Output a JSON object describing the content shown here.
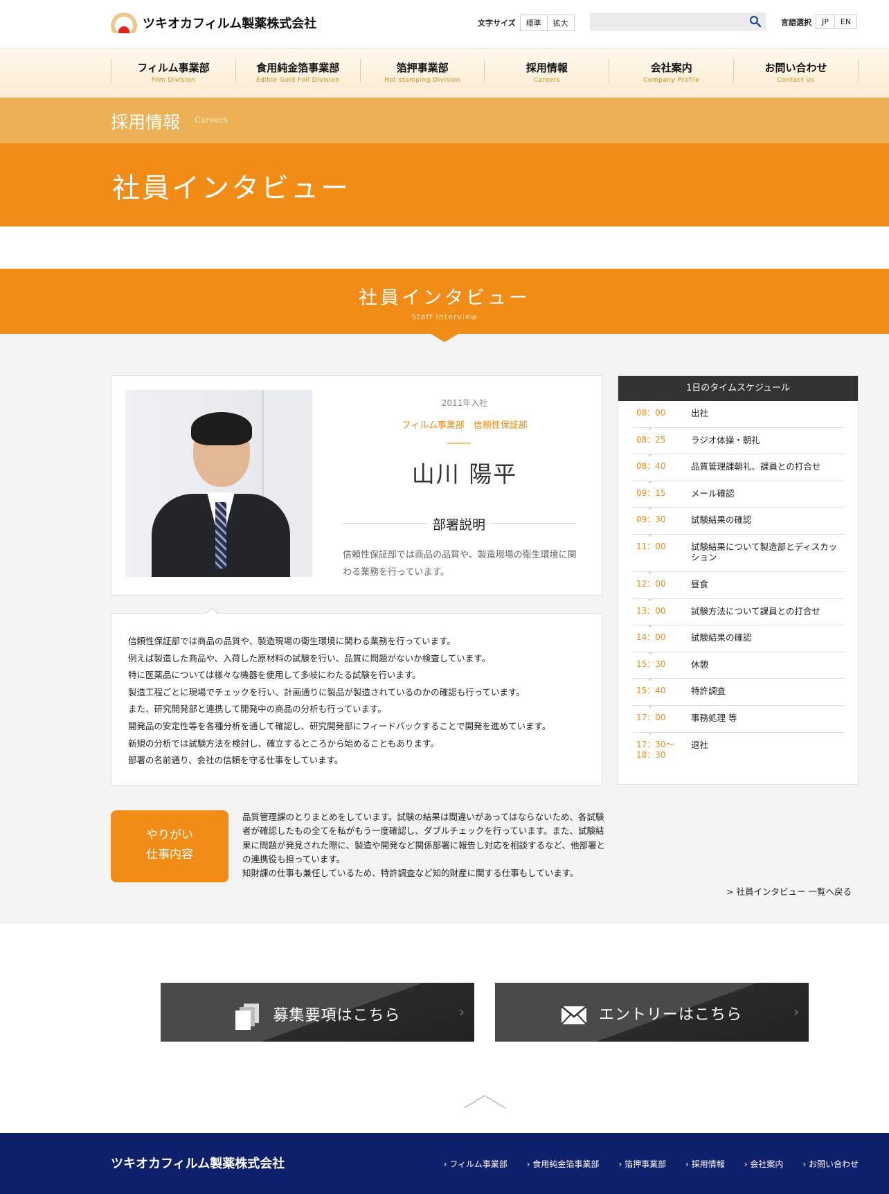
{
  "header": {
    "logo_text": "ツキオカフィルム製薬株式会社",
    "font_size_label": "文字サイズ",
    "font_size_options": [
      "標準",
      "拡大"
    ],
    "search_placeholder": "",
    "lang_label": "言語選択",
    "lang_options": [
      "JP",
      "EN"
    ]
  },
  "nav": [
    {
      "ja": "フィルム事業部",
      "en": "Film Division"
    },
    {
      "ja": "食用純金箔事業部",
      "en": "Edible Gold Foil Division"
    },
    {
      "ja": "箔押事業部",
      "en": "Hot stamping Division"
    },
    {
      "ja": "採用情報",
      "en": "Careers"
    },
    {
      "ja": "会社案内",
      "en": "Company Profile"
    },
    {
      "ja": "お問い合わせ",
      "en": "Contact Us"
    }
  ],
  "breadcrumb": {
    "ja": "採用情報",
    "en": "Careers"
  },
  "page_title": "社員インタビュー",
  "section": {
    "ja": "社員インタビュー",
    "en": "Staff Interview"
  },
  "profile": {
    "joined": "2011年入社",
    "department": "フィルム事業部　信頼性保証部",
    "name": "山川 陽平",
    "dept_heading": "部署説明",
    "dept_desc": "信頼性保証部では商品の品質や、製造現場の衛生環境に関わる業務を行っています。"
  },
  "detail_lines": [
    "信頼性保証部では商品の品質や、製造現場の衛生環境に関わる業務を行っています。",
    "例えば製造した商品や、入荷した原材料の試験を行い、品質に問題がないか検査しています。",
    "特に医薬品については様々な機器を使用して多岐にわたる試験を行います。",
    "製造工程ごとに現場でチェックを行い、計画通りに製品が製造されているのかの確認も行っています。",
    "また、研究開発部と連携して開発中の商品の分析も行っています。",
    "開発品の安定性等を各種分析を通して確認し、研究開発部にフィードバックすることで開発を進めています。",
    "新規の分析では試験方法を検討し、確立するところから始めることもあります。",
    "部署の名前通り、会社の信頼を守る仕事をしています。"
  ],
  "schedule": {
    "title": "1日のタイムスケジュール",
    "rows": [
      {
        "time": "08：00",
        "event": "出社"
      },
      {
        "time": "08：25",
        "event": "ラジオ体操・朝礼"
      },
      {
        "time": "08：40",
        "event": "品質管理課朝礼、課員との打合せ"
      },
      {
        "time": "09：15",
        "event": "メール確認"
      },
      {
        "time": "09：30",
        "event": "試験結果の確認"
      },
      {
        "time": "11：00",
        "event": "試験結果について製造部とディスカッション"
      },
      {
        "time": "12：00",
        "event": "昼食"
      },
      {
        "time": "13：00",
        "event": "試験方法について課員との打合せ"
      },
      {
        "time": "14：00",
        "event": "試験結果の確認"
      },
      {
        "time": "15：30",
        "event": "休憩"
      },
      {
        "time": "15：40",
        "event": "特許調査"
      },
      {
        "time": "17：00",
        "event": "事務処理 等"
      },
      {
        "time": "17：30〜 18：30",
        "event": "退社"
      }
    ]
  },
  "yarigai": {
    "label_line1": "やりがい",
    "label_line2": "仕事内容",
    "text": "品質管理課のとりまとめをしています。試験の結果は間違いがあってはならないため、各試験者が確認したもの全てを私がもう一度確認し、ダブルチェックを行っています。また、試験結果に問題が発見された際に、製造や開発など関係部署に報告し対応を相談するなど、他部署との連携役も担っています。",
    "text2": "知財課の仕事も兼任しているため、特許調査など知的財産に関する仕事もしています。"
  },
  "back_link": "> 社員インタビュー 一覧へ戻る",
  "cta": {
    "recruit": "募集要項はこちら",
    "entry": "エントリーはこちら"
  },
  "footer": {
    "logo_text": "ツキオカフィルム製薬株式会社",
    "links": [
      "フィルム事業部",
      "食用純金箔事業部",
      "箔押事業部",
      "採用情報",
      "会社案内",
      "お問い合わせ"
    ]
  },
  "colors": {
    "accent": "#f18c17",
    "light_accent": "#ebb154",
    "footer": "#0e2069"
  }
}
